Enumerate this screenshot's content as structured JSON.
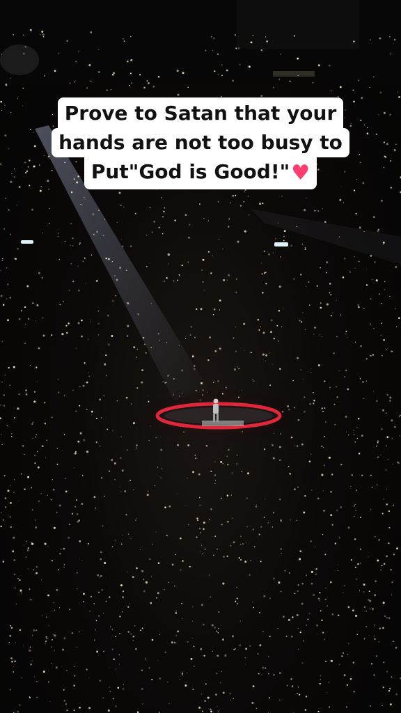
{
  "caption": {
    "line1": "Prove to Satan that your",
    "line2": "hands are not too busy to",
    "line3": "Put\"God is Good!\""
  },
  "icons": {
    "caption_end": "heart-icon"
  },
  "colors": {
    "stage_ring": "#e0283a",
    "phone_lights": "#f5e6c8",
    "caption_background": "#ffffff",
    "heart": "#ff3d6e"
  }
}
